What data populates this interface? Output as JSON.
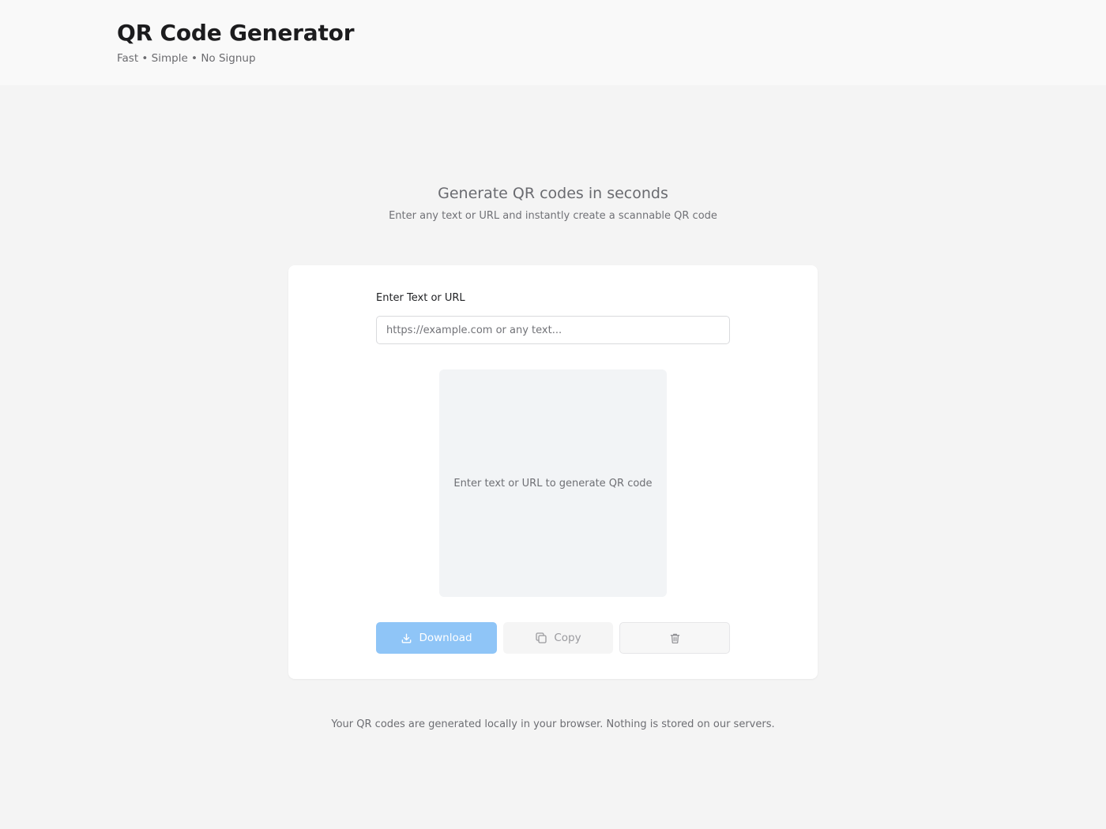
{
  "header": {
    "title": "QR Code Generator",
    "tagline": "Fast • Simple • No Signup"
  },
  "hero": {
    "heading": "Generate QR codes in seconds",
    "subheading": "Enter any text or URL and instantly create a scannable QR code"
  },
  "form": {
    "label": "Enter Text or URL",
    "value": "",
    "placeholder": "https://example.com or any text..."
  },
  "preview": {
    "empty_message": "Enter text or URL to generate QR code"
  },
  "actions": {
    "download_label": "Download",
    "copy_label": "Copy",
    "download_icon": "download-icon",
    "copy_icon": "copy-icon",
    "delete_icon": "trash-icon"
  },
  "footer": {
    "note": "Your QR codes are generated locally in your browser. Nothing is stored on our servers."
  },
  "colors": {
    "accent": "#8fc5f7",
    "background": "#f4f4f4",
    "card": "#ffffff",
    "preview_bg": "#f2f4f6"
  }
}
